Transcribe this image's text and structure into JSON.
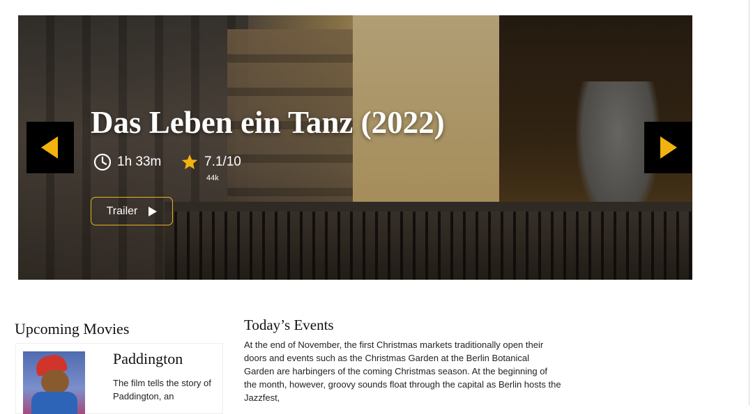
{
  "hero": {
    "title": "Das Leben ein Tanz (2022)",
    "runtime": "1h 33m",
    "rating": "7.1/10",
    "votes": "44k",
    "trailer_label": "Trailer",
    "icons": {
      "runtime": "clock-icon",
      "rating": "star-icon",
      "trailer": "play-icon",
      "prev": "chevron-left-icon",
      "next": "chevron-right-icon"
    }
  },
  "upcoming": {
    "title": "Upcoming Movies",
    "movies": [
      {
        "title": "Paddington",
        "description": "The film tells the story of Paddington, an"
      }
    ]
  },
  "events": {
    "title": "Today’s Events",
    "body": "At the end of November, the first Christmas markets traditionally open their doors and events such as the Christmas Garden at the Berlin Botanical Garden are harbingers of the coming Christmas season. At the beginning of the month, however, groovy sounds float through the capital as Berlin hosts the Jazzfest,"
  },
  "colors": {
    "accent": "#f2b20f",
    "button_border": "#e6b422",
    "text": "#111111"
  }
}
